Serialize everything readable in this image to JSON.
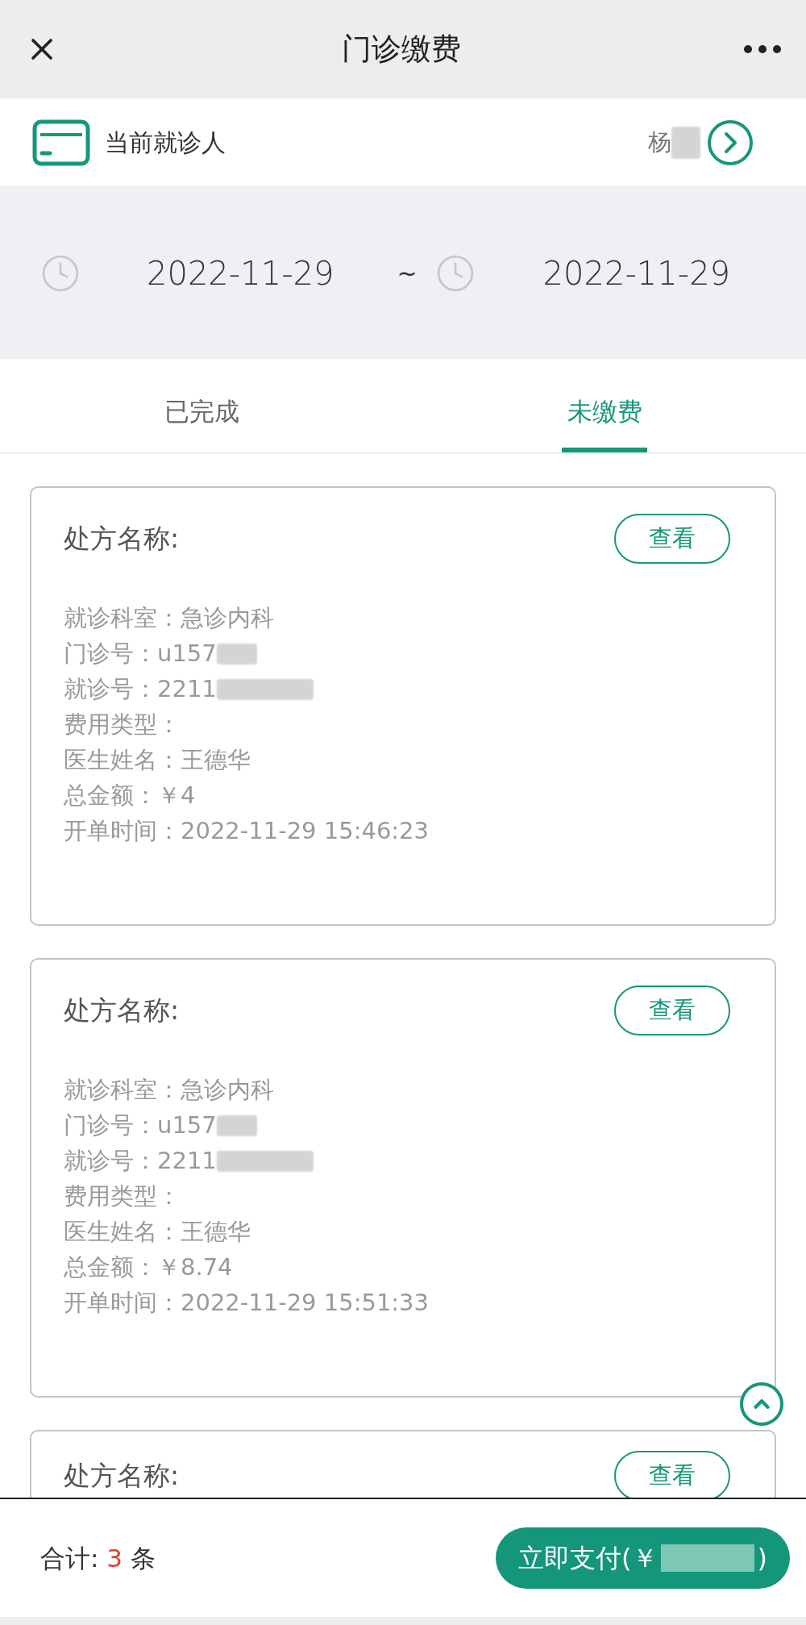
{
  "header": {
    "title": "门诊缴费"
  },
  "patient": {
    "label": "当前就诊人",
    "name": "杨",
    "name_redacted": true
  },
  "dates": {
    "start": "2022-11-29",
    "separator": "~",
    "end": "2022-11-29"
  },
  "tabs": [
    {
      "label": "已完成",
      "selected": false
    },
    {
      "label": "未缴费",
      "selected": true
    }
  ],
  "cards": [
    {
      "title": "处方名称:",
      "button": "查看",
      "lines": [
        {
          "text": "就诊科室：急诊内科",
          "redacted": false
        },
        {
          "text": "门诊号：u157",
          "redacted": true
        },
        {
          "text": "就诊号：2211",
          "redacted": true
        },
        {
          "text": "费用类型：",
          "redacted": false
        },
        {
          "text": "医生姓名：王德华",
          "redacted": false
        },
        {
          "text": "总金额：￥4",
          "redacted": false
        },
        {
          "text": "开单时间：2022-11-29 15:46:23",
          "redacted": false
        }
      ]
    },
    {
      "title": "处方名称:",
      "button": "查看",
      "lines": [
        {
          "text": "就诊科室：急诊内科",
          "redacted": false
        },
        {
          "text": "门诊号：u157",
          "redacted": true
        },
        {
          "text": "就诊号：2211",
          "redacted": true
        },
        {
          "text": "费用类型：",
          "redacted": false
        },
        {
          "text": "医生姓名：王德华",
          "redacted": false
        },
        {
          "text": "总金额：￥8.74",
          "redacted": false
        },
        {
          "text": "开单时间：2022-11-29 15:51:33",
          "redacted": false
        }
      ]
    },
    {
      "title": "处方名称:",
      "button": "查看"
    }
  ],
  "footer": {
    "total_label": "合计:",
    "count": "3",
    "unit": "条",
    "pay_label": "立即支付(￥",
    "pay_redacted": true,
    "pay_suffix": ")"
  }
}
